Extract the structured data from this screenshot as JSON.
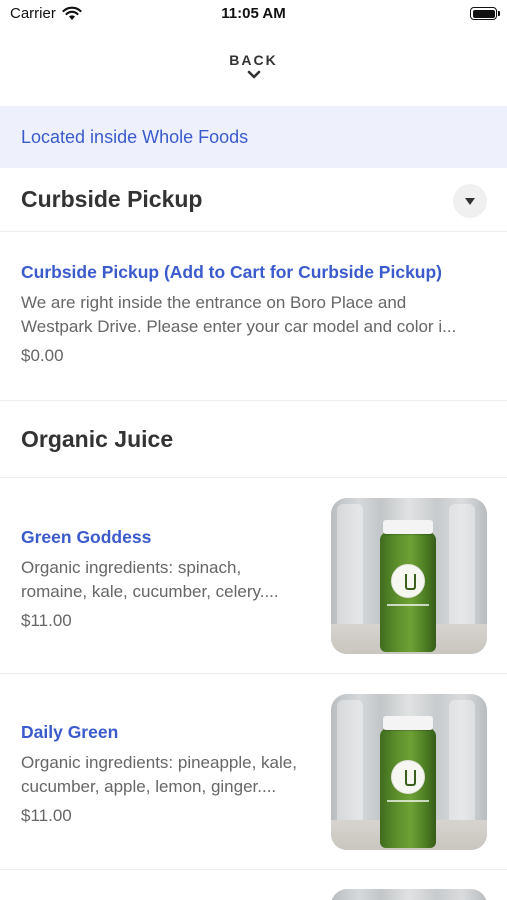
{
  "status_bar": {
    "carrier": "Carrier",
    "time": "11:05 AM"
  },
  "nav": {
    "back_label": "BACK"
  },
  "banner": {
    "text": "Located inside Whole Foods"
  },
  "sections": [
    {
      "title": "Curbside Pickup",
      "items": [
        {
          "name": "Curbside Pickup (Add to Cart for Curbside Pickup)",
          "description_lines": [
            "We are right inside the entrance on Boro Place and",
            "Westpark Drive. Please enter your car model and color i..."
          ],
          "price": "$0.00"
        }
      ]
    },
    {
      "title": "Organic Juice",
      "items": [
        {
          "name": "Green Goddess",
          "description_lines": [
            "Organic ingredients: spinach,",
            "romaine, kale, cucumber, celery...."
          ],
          "price": "$11.00"
        },
        {
          "name": "Daily Green",
          "description_lines": [
            "Organic ingredients: pineapple, kale,",
            "cucumber, apple, lemon, ginger...."
          ],
          "price": "$11.00"
        }
      ]
    }
  ],
  "colors": {
    "accent": "#3b5bcc",
    "banner_bg": "#eef1fb",
    "text_primary": "#333333",
    "text_secondary": "#666666"
  }
}
